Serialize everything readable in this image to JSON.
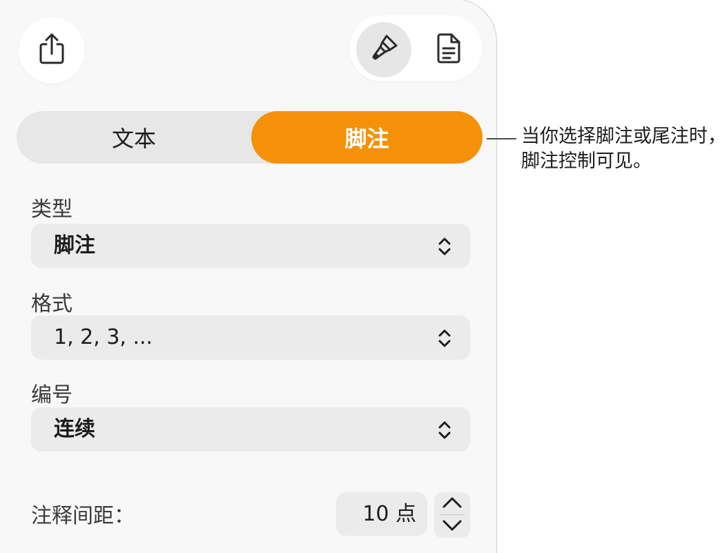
{
  "tabs": {
    "text_label": "文本",
    "footnote_label": "脚注",
    "active": "footnote"
  },
  "fields": {
    "type": {
      "label": "类型",
      "value": "脚注"
    },
    "format": {
      "label": "格式",
      "value": "1, 2, 3, ..."
    },
    "numbering": {
      "label": "编号",
      "value": "连续"
    }
  },
  "spacing": {
    "label": "注释间距：",
    "value": "10 点"
  },
  "callout": {
    "line1": "当你选择脚注或尾注时，",
    "line2": "脚注控制可见。"
  },
  "icons": {
    "share": "share-icon",
    "format": "paintbrush-icon",
    "document": "document-icon",
    "chevrons": "chevron-up-down-icon"
  },
  "colors": {
    "accent": "#f59108",
    "panel": "#f8f8f8",
    "control": "#ebebeb"
  }
}
